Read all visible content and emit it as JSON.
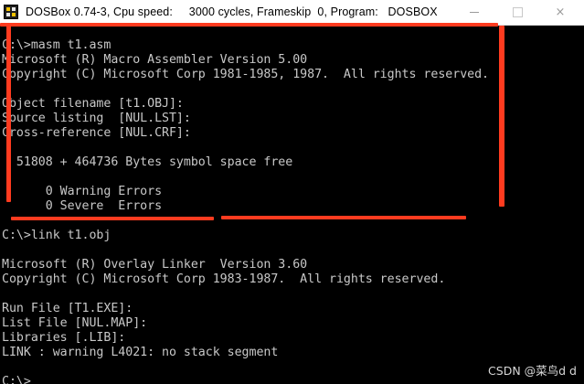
{
  "window": {
    "title": "DOSBox 0.74-3, Cpu speed:     3000 cycles, Frameskip  0, Program:   DOSBOX",
    "close_glyph": "×"
  },
  "terminal": {
    "text_color": "#c8c8c8",
    "background": "#000000",
    "lines": [
      "C:\\>masm t1.asm",
      "Microsoft (R) Macro Assembler Version 5.00",
      "Copyright (C) Microsoft Corp 1981-1985, 1987.  All rights reserved.",
      "",
      "Object filename [t1.OBJ]:",
      "Source listing  [NUL.LST]:",
      "Cross-reference [NUL.CRF]:",
      "",
      "  51808 + 464736 Bytes symbol space free",
      "",
      "      0 Warning Errors",
      "      0 Severe  Errors",
      "",
      "C:\\>link t1.obj",
      "",
      "Microsoft (R) Overlay Linker  Version 3.60",
      "Copyright (C) Microsoft Corp 1983-1987.  All rights reserved.",
      "",
      "Run File [T1.EXE]:",
      "List File [NUL.MAP]:",
      "Libraries [.LIB]:",
      "LINK : warning L4021: no stack segment",
      "",
      "C:\\>"
    ]
  },
  "annotation": {
    "color": "#ff3b1f"
  },
  "watermark": {
    "text": "CSDN @菜鸟d d"
  }
}
